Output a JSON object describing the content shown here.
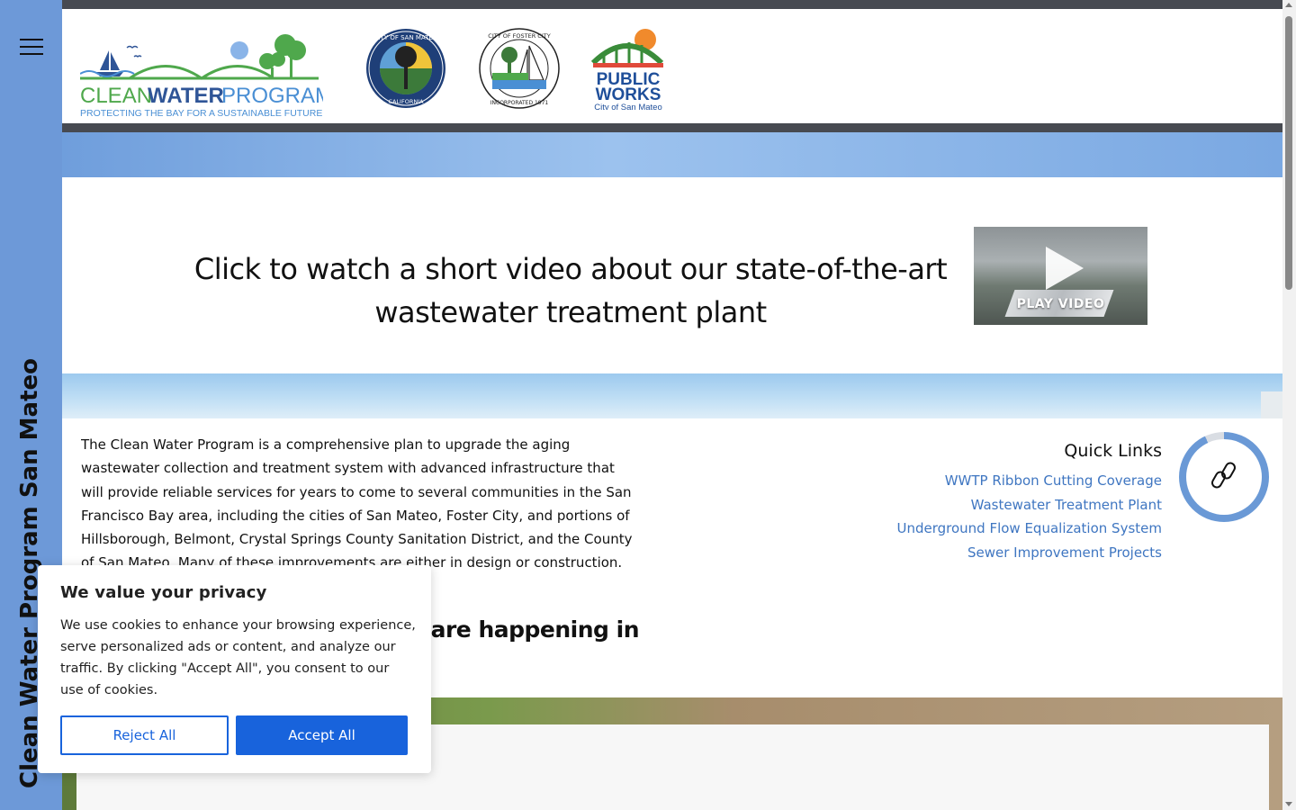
{
  "sidebar": {
    "vertical_title": "Clean Water Program San Mateo"
  },
  "header": {
    "logo_main": "CLEANWATERPROGRAM",
    "logo_main_a": "CLEAN",
    "logo_main_b": "WATER",
    "logo_main_c": "PROGRAM",
    "logo_tagline": "PROTECTING THE BAY FOR A SUSTAINABLE FUTURE",
    "seal_san_mateo_top": "CITY OF SAN MATEO",
    "seal_san_mateo_bottom": "CALIFORNIA",
    "seal_foster_top": "CITY OF FOSTER CITY",
    "seal_foster_bottom": "INCORPORATED 1971",
    "pw_line1": "PUBLIC",
    "pw_line2": "WORKS",
    "pw_sub": "City of San Mateo"
  },
  "video": {
    "text": "Click to watch a short video about our state-of-the-art wastewater treatment plant",
    "button_label": "PLAY VIDEO"
  },
  "intro": {
    "text": "The Clean Water Program is a comprehensive plan to upgrade the aging wastewater collection and treatment system with advanced infrastructure that will provide reliable services for years to come to several communities in the San Francisco Bay area, including the cities of San Mateo, Foster City, and portions of Hillsborough, Belmont, Crystal Springs County Sanitation District, and the County of San Mateo. Many of these improvements are either in design or construction. Some of the construction has been",
    "heading_fragment": "cts are happening in"
  },
  "quick_links": {
    "title": "Quick Links",
    "items": [
      "WWTP Ribbon Cutting Coverage",
      "Wastewater Treatment Plant",
      "Underground Flow Equalization System",
      "Sewer Improvement Projects"
    ]
  },
  "cookie": {
    "title": "We value your privacy",
    "body": "We use cookies to enhance your browsing experience, serve personalized ads or content, and analyze our traffic. By clicking \"Accept All\", you consent to our use of cookies.",
    "reject": "Reject All",
    "accept": "Accept All"
  },
  "colors": {
    "sidebar": "#6d99d8",
    "dark_bar": "#474a51",
    "link": "#3f76c1",
    "cookie_button": "#1863dc"
  }
}
